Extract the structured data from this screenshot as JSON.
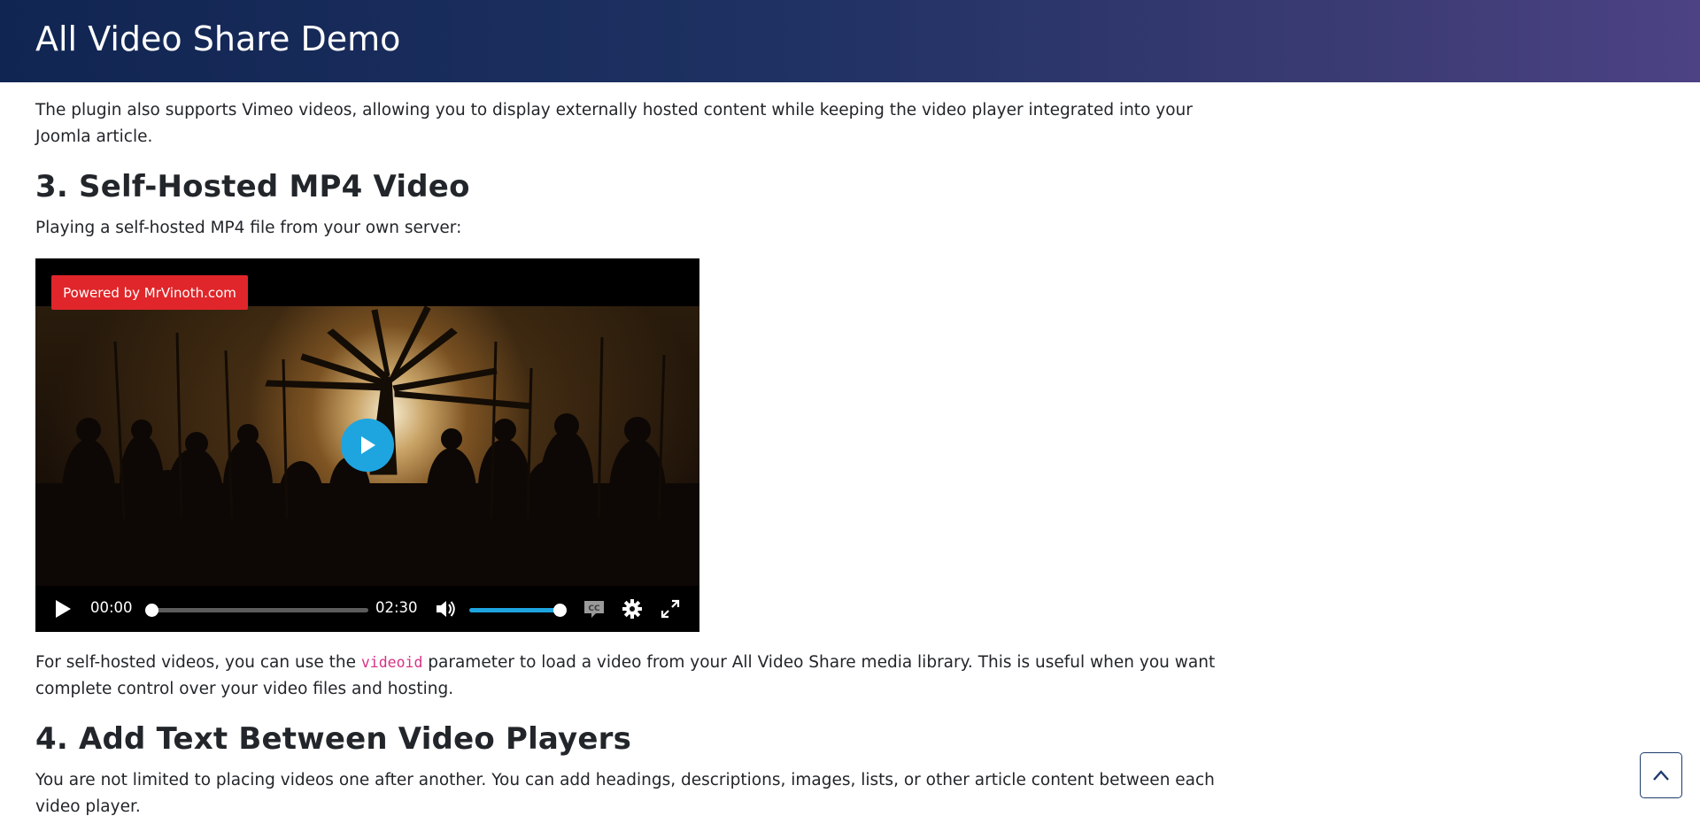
{
  "header": {
    "title": "All Video Share Demo",
    "gradient_start": "#112552",
    "gradient_end": "#4c4285"
  },
  "article": {
    "intro": "The plugin also supports Vimeo videos, allowing you to display externally hosted content while keeping the video player integrated into your Joomla article.",
    "section3": {
      "heading": "3. Self-Hosted MP4 Video",
      "description": "Playing a self-hosted MP4 file from your own server:"
    },
    "after_player": {
      "before_code": "For self-hosted videos, you can use the ",
      "code": "videoid",
      "after_code": " parameter to load a video from your All Video Share media library. This is useful when you want complete control over your video files and hosting."
    },
    "section4": {
      "heading": "4. Add Text Between Video Players",
      "description": "You are not limited to placing videos one after another. You can add headings, descriptions, images, lists, or other article content between each video player."
    }
  },
  "player": {
    "watermark": "Powered by MrVinoth.com",
    "current_time": "00:00",
    "duration": "02:30",
    "progress": 0,
    "volume": 1.0,
    "accent_color": "#1ea5e0",
    "watermark_color": "#e0262a",
    "icons": [
      "play-icon",
      "volume-icon",
      "captions-icon",
      "settings-icon",
      "fullscreen-icon"
    ]
  },
  "back_to_top": {
    "icon": "chevron-up-icon"
  }
}
